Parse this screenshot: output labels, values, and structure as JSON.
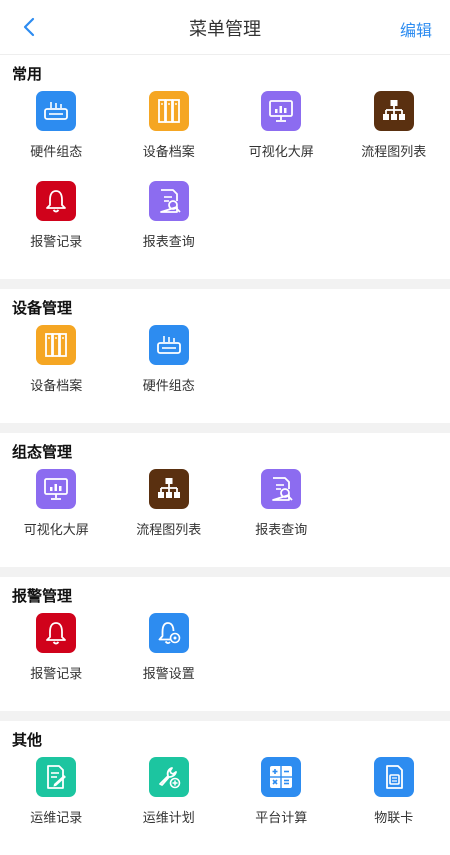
{
  "header": {
    "title": "菜单管理",
    "edit_label": "编辑"
  },
  "sections": [
    {
      "title": "常用",
      "items": [
        {
          "label": "硬件组态",
          "icon": "hardware-config-icon",
          "color": "#2d8cf0"
        },
        {
          "label": "设备档案",
          "icon": "device-archive-icon",
          "color": "#f5a623"
        },
        {
          "label": "可视化大屏",
          "icon": "visual-screen-icon",
          "color": "#8c6cf0"
        },
        {
          "label": "流程图列表",
          "icon": "flowchart-icon",
          "color": "#5a3010"
        },
        {
          "label": "报警记录",
          "icon": "alarm-bell-icon",
          "color": "#d0021b"
        },
        {
          "label": "报表查询",
          "icon": "report-query-icon",
          "color": "#8c6cf0"
        }
      ]
    },
    {
      "title": "设备管理",
      "items": [
        {
          "label": "设备档案",
          "icon": "device-archive-icon",
          "color": "#f5a623"
        },
        {
          "label": "硬件组态",
          "icon": "hardware-config-icon",
          "color": "#2d8cf0"
        }
      ]
    },
    {
      "title": "组态管理",
      "items": [
        {
          "label": "可视化大屏",
          "icon": "visual-screen-icon",
          "color": "#8c6cf0"
        },
        {
          "label": "流程图列表",
          "icon": "flowchart-icon",
          "color": "#5a3010"
        },
        {
          "label": "报表查询",
          "icon": "report-query-icon",
          "color": "#8c6cf0"
        }
      ]
    },
    {
      "title": "报警管理",
      "items": [
        {
          "label": "报警记录",
          "icon": "alarm-bell-icon",
          "color": "#d0021b"
        },
        {
          "label": "报警设置",
          "icon": "alarm-settings-icon",
          "color": "#2d8cf0"
        }
      ]
    },
    {
      "title": "其他",
      "items": [
        {
          "label": "运维记录",
          "icon": "maintenance-record-icon",
          "color": "#1cc5a0"
        },
        {
          "label": "运维计划",
          "icon": "maintenance-plan-icon",
          "color": "#1cc5a0"
        },
        {
          "label": "平台计算",
          "icon": "calculator-icon",
          "color": "#2d8cf0"
        },
        {
          "label": "物联卡",
          "icon": "sim-card-icon",
          "color": "#2d8cf0"
        }
      ]
    }
  ]
}
